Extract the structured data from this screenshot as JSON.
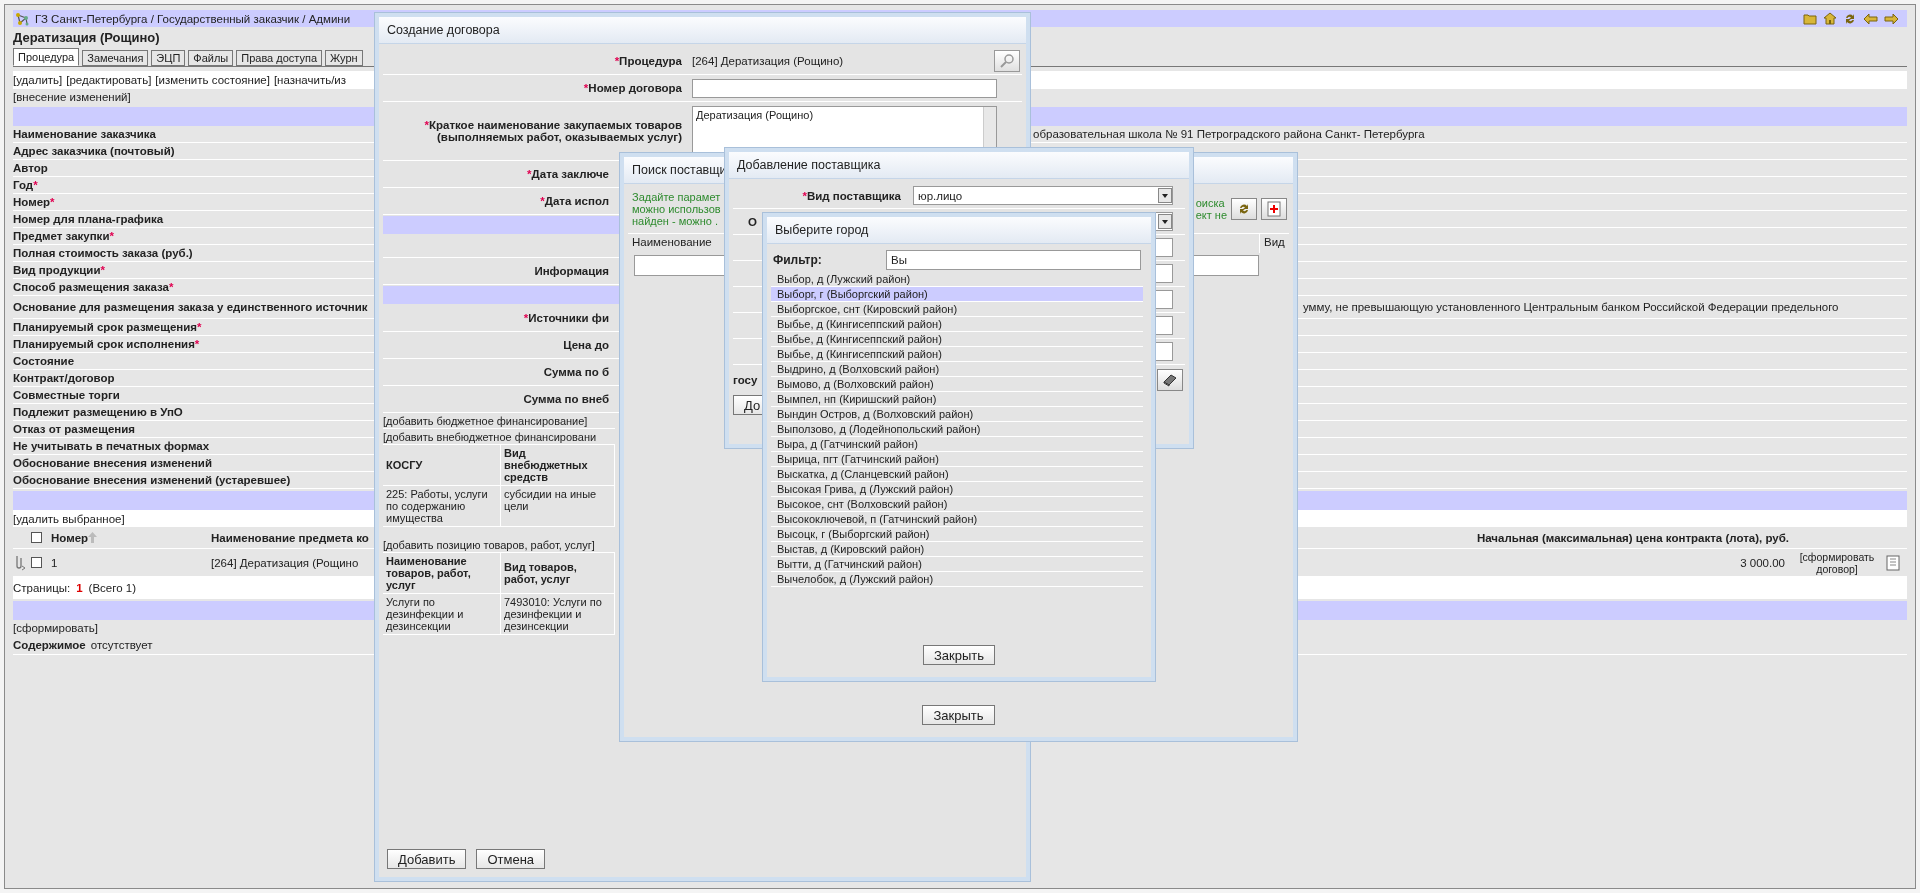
{
  "breadcrumb": "ГЗ Санкт-Петербурга / Государственный заказчик / Админи",
  "title": "Дератизация (Рощино)",
  "tabs": [
    {
      "label": "Процедура",
      "selected": true
    },
    {
      "label": "Замечания",
      "selected": false
    },
    {
      "label": "ЭЦП",
      "selected": false
    },
    {
      "label": "Файлы",
      "selected": false
    },
    {
      "label": "Права доступа",
      "selected": false
    },
    {
      "label": "Журн",
      "selected": false
    }
  ],
  "actions": [
    "[удалить]",
    "[редактировать]",
    "[изменить состояние]",
    "[назначить/из"
  ],
  "change_link": "[внесение изменений]",
  "details": [
    {
      "label": "Наименование заказчика",
      "value": "образовательная школа № 91 Петроградского района Санкт- Петербурга"
    },
    {
      "label": "Адрес заказчика (почтовый)"
    },
    {
      "label": "Автор"
    },
    {
      "label": "Год",
      "mark": "*"
    },
    {
      "label": "Номер",
      "mark": "*"
    },
    {
      "label": "Номер для плана-графика"
    },
    {
      "label": "Предмет закупки",
      "mark": "*"
    },
    {
      "label": "Полная стоимость заказа (руб.)"
    },
    {
      "label": "Вид продукции",
      "mark": "*"
    },
    {
      "label": "Способ размещения заказа",
      "mark": "*"
    },
    {
      "label": "Основание для размещения заказа у единственного источник",
      "value": "умму, не превышающую установленного Центральным банком Российской Федерации предельного"
    },
    {
      "label": "Планируемый срок размещения",
      "mark": "*"
    },
    {
      "label": "Планируемый срок исполнения",
      "mark": "*"
    },
    {
      "label": "Состояние"
    },
    {
      "label": "Контракт/договор"
    },
    {
      "label": "Совместные торги"
    },
    {
      "label": "Подлежит размещению в УпО"
    },
    {
      "label": "Отказ от размещения"
    },
    {
      "label": "Не учитывать в печатных формах"
    },
    {
      "label": "Обоснование внесения изменений"
    },
    {
      "label": "Обоснование внесения изменений (устаревшее)"
    }
  ],
  "lots": {
    "delete_link": "[удалить выбранное]",
    "select_all_checked": false,
    "columns": [
      "Номер",
      "Наименование предмета ко",
      "Начальная (максимальная) цена контракта (лота), руб."
    ],
    "rows": [
      {
        "checked": false,
        "number": "1",
        "name": "[264] Дератизация (Рощино",
        "price": "3 000.00",
        "action": "[сформировать договор]"
      }
    ],
    "pager_label": "Страницы:",
    "current_page": "1",
    "total": "(Всего 1)"
  },
  "form_link": "[сформировать]",
  "contents": {
    "label": "Содержимое",
    "value": "отсутствует"
  },
  "contract_dialog": {
    "title": "Создание договора",
    "fields": [
      {
        "kind": "lookup",
        "mark": "*",
        "label": "Процедура",
        "value": "[264] Дератизация (Рощино)"
      },
      {
        "kind": "input",
        "mark": "*",
        "label": "Номер договора"
      },
      {
        "kind": "textarea",
        "mark": "*",
        "label": "Краткое наименование закупаемых товаров (выполняемых работ, оказываемых услуг)",
        "value": "Дератизация (Рощино)"
      },
      {
        "kind": "cut",
        "mark": "*",
        "label": "Дата заключе"
      },
      {
        "kind": "cut",
        "mark": "*",
        "label": "Дата испол"
      },
      {
        "kind": "band"
      },
      {
        "kind": "blank"
      },
      {
        "kind": "cut",
        "label": "Информация"
      },
      {
        "kind": "band"
      },
      {
        "kind": "cut",
        "mark": "*",
        "label": "Источники фи"
      },
      {
        "kind": "cut",
        "label": "Цена до"
      },
      {
        "kind": "cut",
        "label": "Сумма по б"
      },
      {
        "kind": "cut",
        "label": "Сумма по внеб"
      }
    ],
    "links": [
      "[добавить бюджетное финансирование]",
      "[добавить внебюджетное финансировани"
    ],
    "kosgu_table": {
      "columns": [
        "КОСГУ",
        "Вид внебюджетных средств"
      ],
      "rows": [
        [
          "225: Работы, услуги по содержанию имущества",
          "субсидии на иные цели"
        ]
      ]
    },
    "items_link": "[добавить позицию товаров, работ, услуг]",
    "items_table": {
      "columns": [
        "Наименование товаров, работ, услуг",
        "Вид товаров, работ, услуг"
      ],
      "rows": [
        [
          "Услуги по дезинфекции и дезинсекции",
          "7493010: Услуги по дезинфекции и дезинсекции"
        ]
      ]
    },
    "buttons": [
      "Добавить",
      "Отмена"
    ]
  },
  "supplier_search": {
    "title": "Поиск поставщи",
    "hint_left": [
      "Задайте парамет",
      "можно использов",
      "найден - можно ."
    ],
    "hint_right": [
      "оиска",
      "ект не"
    ],
    "columns": [
      "Наименование",
      "Вид"
    ],
    "button": "Закрыть"
  },
  "add_supplier": {
    "title": "Добавление поставщика",
    "fields": [
      {
        "kind": "select",
        "mark": "*",
        "label": "Вид поставщика",
        "value": "юр.лицо"
      },
      {
        "kind": "select",
        "label": "О"
      },
      {
        "kind": "input"
      },
      {
        "kind": "input"
      },
      {
        "kind": "input"
      },
      {
        "kind": "input"
      },
      {
        "kind": "input"
      },
      {
        "kind": "book",
        "label": "госу"
      }
    ],
    "button": "До"
  },
  "city_picker": {
    "title": "Выберите город",
    "filter_label": "Фильтр:",
    "filter_value": "Вы",
    "cities": [
      {
        "name": "Выбор, д (Лужский район)",
        "selected": false
      },
      {
        "name": "Выборг, г (Выборгский район)",
        "selected": true
      },
      {
        "name": "Выборгское, снт (Кировский район)",
        "selected": false
      },
      {
        "name": "Выбье, д (Кингисеппский район)",
        "selected": false
      },
      {
        "name": "Выбье, д (Кингисеппский район)",
        "selected": false
      },
      {
        "name": "Выбье, д (Кингисеппский район)",
        "selected": false
      },
      {
        "name": "Выдрино, д (Волховский район)",
        "selected": false
      },
      {
        "name": "Вымово, д (Волховский район)",
        "selected": false
      },
      {
        "name": "Вымпел, нп (Киришский район)",
        "selected": false
      },
      {
        "name": "Вындин Остров, д (Волховский район)",
        "selected": false
      },
      {
        "name": "Выползово, д (Лодейнопольский район)",
        "selected": false
      },
      {
        "name": "Выра, д (Гатчинский район)",
        "selected": false
      },
      {
        "name": "Вырица, пгт (Гатчинский район)",
        "selected": false
      },
      {
        "name": "Выскатка, д (Сланцевский район)",
        "selected": false
      },
      {
        "name": "Высокая Грива, д (Лужский район)",
        "selected": false
      },
      {
        "name": "Высокое, снт (Волховский район)",
        "selected": false
      },
      {
        "name": "Высокоключевой, п (Гатчинский район)",
        "selected": false
      },
      {
        "name": "Высоцк, г (Выборгский район)",
        "selected": false
      },
      {
        "name": "Выстав, д (Кировский район)",
        "selected": false
      },
      {
        "name": "Вытти, д (Гатчинский район)",
        "selected": false
      },
      {
        "name": "Вычелобок, д (Лужский район)",
        "selected": false
      }
    ],
    "button": "Закрыть"
  }
}
